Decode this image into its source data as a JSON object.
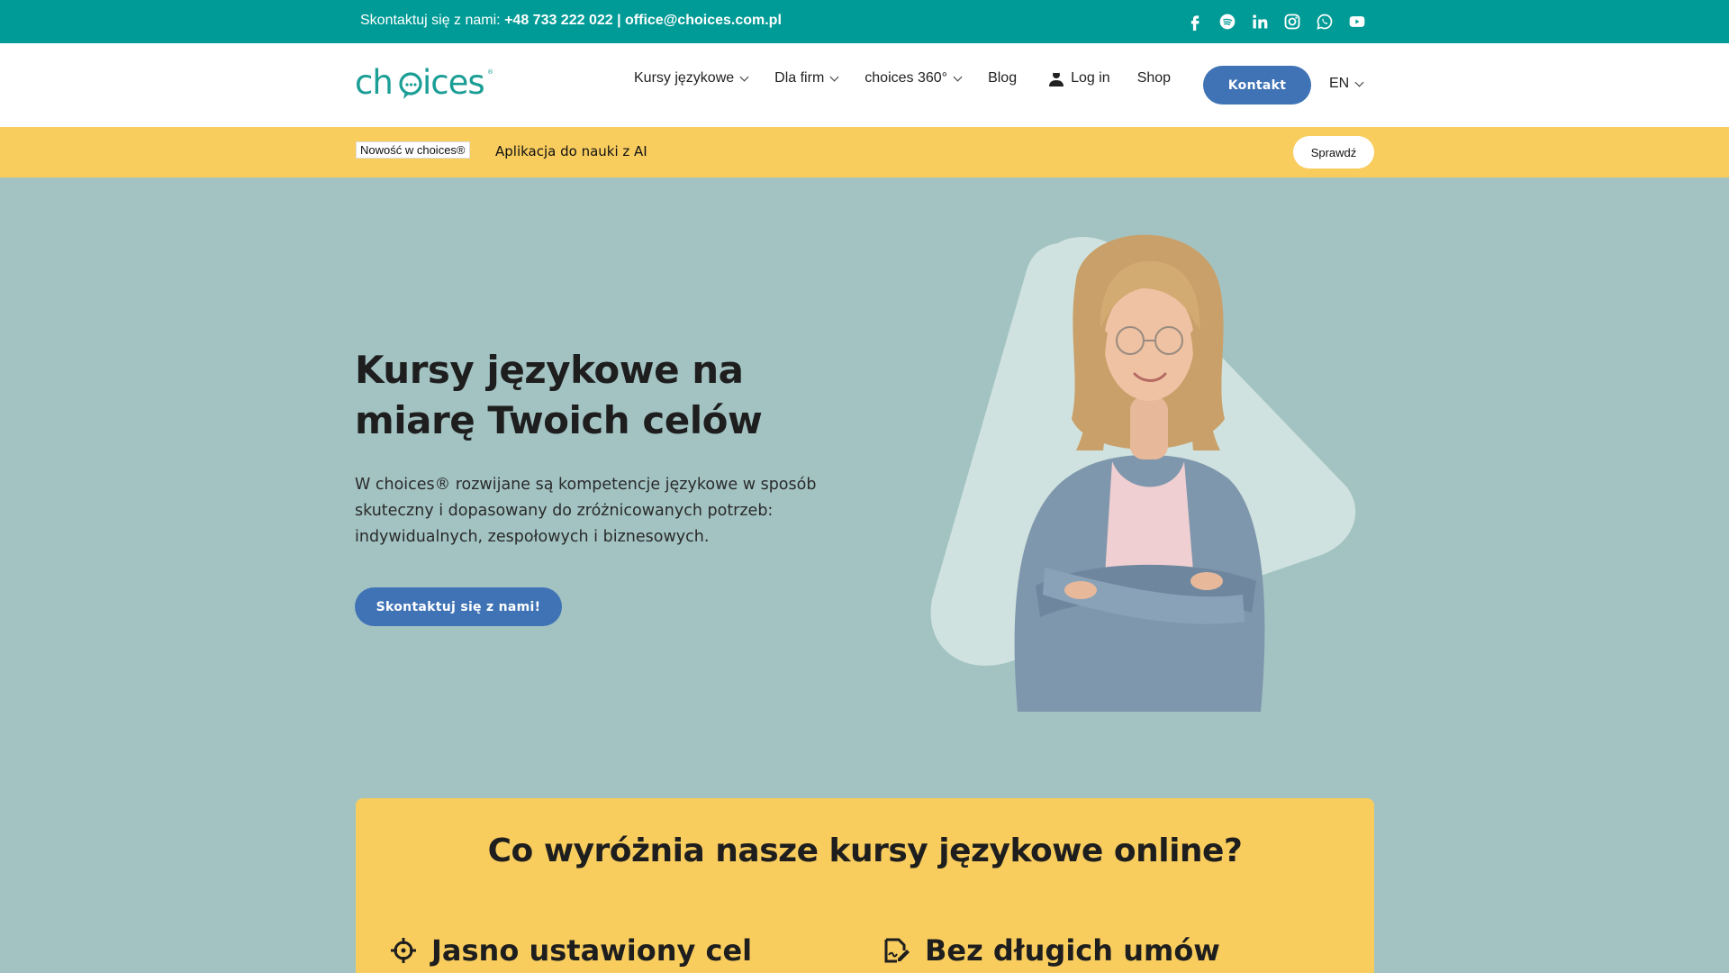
{
  "topbar": {
    "contact_prefix": "Skontaktuj się z nami:",
    "phone": "+48 733 222 022",
    "separator": "|",
    "email": "office@choices.com.pl",
    "socials": [
      "facebook-icon",
      "spotify-icon",
      "linkedin-icon",
      "instagram-icon",
      "whatsapp-icon",
      "youtube-icon"
    ]
  },
  "header": {
    "logo_text": "choices",
    "nav": [
      {
        "label": "Kursy językowe",
        "dropdown": true
      },
      {
        "label": "Dla firm",
        "dropdown": true
      },
      {
        "label": "choices 360°",
        "dropdown": true
      },
      {
        "label": "Blog",
        "dropdown": false
      },
      {
        "label": "Log in",
        "dropdown": false
      },
      {
        "label": "Shop",
        "dropdown": false
      }
    ],
    "contact_button": "Kontakt",
    "language": "EN"
  },
  "announcement": {
    "badge": "Nowość w choices®",
    "text": "Aplikacja do nauki z AI",
    "button": "Sprawdź"
  },
  "hero": {
    "title": "Kursy językowe na miarę Twoich celów",
    "description": "W choices® rozwijane są kompetencje językowe w sposób skuteczny i dopasowany do zróżnicowanych potrzeb: indywidualnych, zespołowych i biznesowych.",
    "button": "Skontaktuj się z nami!"
  },
  "features": {
    "title": "Co wyróżnia nasze kursy językowe online?",
    "items": [
      {
        "label": "Jasno ustawiony cel",
        "icon": "crosshair-icon"
      },
      {
        "label": "Bez długich umów",
        "icon": "signature-icon"
      }
    ]
  },
  "colors": {
    "teal": "#009b96",
    "accent_blue": "#3f73b5",
    "yellow": "#f8cd5e",
    "hero_bg": "#a3c3c3"
  }
}
